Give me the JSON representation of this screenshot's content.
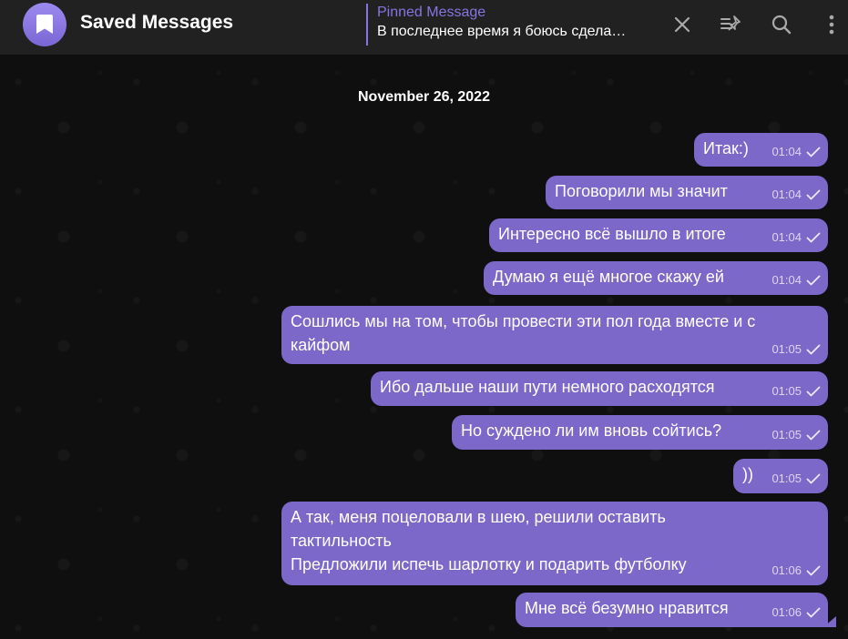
{
  "header": {
    "title": "Saved Messages",
    "pinned_title": "Pinned Message",
    "pinned_text": "В последнее время я боюсь сдела…"
  },
  "chat": {
    "date": "November 26, 2022",
    "messages": [
      {
        "text": "Итак:)",
        "time": "01:04"
      },
      {
        "text": "Поговорили мы значит",
        "time": "01:04"
      },
      {
        "text": "Интересно всё вышло в итоге",
        "time": "01:04"
      },
      {
        "text": "Думаю я ещё многое скажу ей",
        "time": "01:04"
      },
      {
        "text": "Сошлись мы на том, чтобы провести эти пол года вместе и с\nкайфом",
        "time": "01:05"
      },
      {
        "text": "Ибо дальше наши пути немного расходятся",
        "time": "01:05"
      },
      {
        "text": "Но суждено ли им вновь сойтись?",
        "time": "01:05"
      },
      {
        "text": "))",
        "time": "01:05"
      },
      {
        "text": "А так, меня поцеловали в шею, решили оставить\nтактильность\nПредложили испечь шарлотку и подарить футболку",
        "time": "01:06"
      },
      {
        "text": "Мне всё безумно нравится",
        "time": "01:06"
      }
    ]
  },
  "icons": {
    "avatar": "bookmark-icon",
    "close": "close-icon",
    "pinned_list": "pinned-list-icon",
    "search": "search-icon",
    "more": "more-vertical-icon",
    "read": "check-icon"
  },
  "colors": {
    "header_bg": "#212121",
    "bubble": "#7b68c9",
    "accent": "#8774e1"
  }
}
